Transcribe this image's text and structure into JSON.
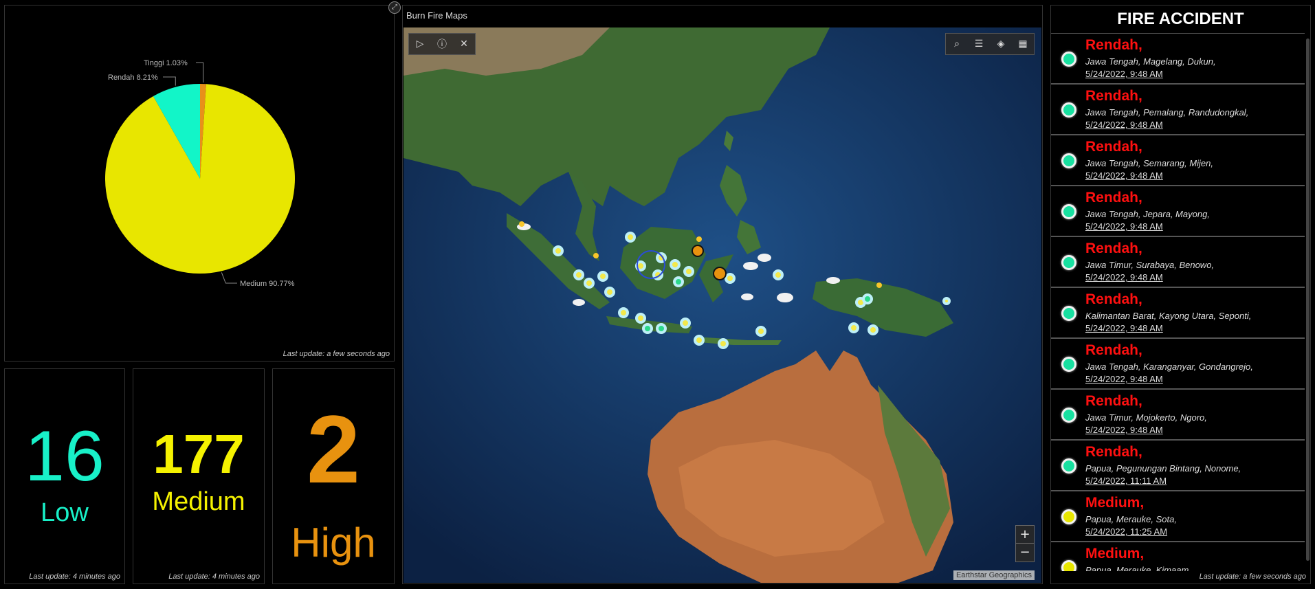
{
  "pie": {
    "footer": "Last update: a few seconds ago",
    "chart_data": {
      "type": "pie",
      "categories": [
        "Tinggi",
        "Rendah",
        "Medium"
      ],
      "values": [
        1.03,
        8.21,
        90.77
      ],
      "labels": [
        "Tinggi 1.03%",
        "Rendah 8.21%",
        "Medium 90.77%"
      ],
      "colors": [
        "#e8901a",
        "#12f5c8",
        "#e8e600"
      ]
    }
  },
  "indicators": [
    {
      "value": "16",
      "label": "Low",
      "color": "#18f0c8",
      "footer": "Last update: 4 minutes ago"
    },
    {
      "value": "177",
      "label": "Medium",
      "color": "#f5f200",
      "footer": "Last update: 4 minutes ago"
    },
    {
      "value": "2",
      "label": "High",
      "color": "#e8920f",
      "footer": ""
    }
  ],
  "map": {
    "title": "Burn Fire Maps",
    "attribution": "Earthstar Geographics",
    "zoom_in": "+",
    "zoom_out": "−"
  },
  "list": {
    "title": "FIRE ACCIDENT",
    "footer": "Last update: a few seconds ago",
    "items": [
      {
        "level": "Rendah,",
        "location": "Jawa Tengah, Magelang, Dukun,",
        "date": "5/24/2022, 9:48 AM",
        "dot": "#18e0a0"
      },
      {
        "level": "Rendah,",
        "location": "Jawa Tengah, Pemalang, Randudongkal,",
        "date": "5/24/2022, 9:48 AM",
        "dot": "#18e0a0"
      },
      {
        "level": "Rendah,",
        "location": "Jawa Tengah, Semarang, Mijen,",
        "date": "5/24/2022, 9:48 AM",
        "dot": "#18e0a0"
      },
      {
        "level": "Rendah,",
        "location": "Jawa Tengah, Jepara, Mayong,",
        "date": "5/24/2022, 9:48 AM",
        "dot": "#18e0a0"
      },
      {
        "level": "Rendah,",
        "location": "Jawa Timur, Surabaya, Benowo,",
        "date": "5/24/2022, 9:48 AM",
        "dot": "#18e0a0"
      },
      {
        "level": "Rendah,",
        "location": "Kalimantan Barat, Kayong Utara, Seponti,",
        "date": "5/24/2022, 9:48 AM",
        "dot": "#18e0a0"
      },
      {
        "level": "Rendah,",
        "location": "Jawa Tengah, Karanganyar, Gondangrejo,",
        "date": "5/24/2022, 9:48 AM",
        "dot": "#18e0a0"
      },
      {
        "level": "Rendah,",
        "location": "Jawa Timur, Mojokerto, Ngoro,",
        "date": "5/24/2022, 9:48 AM",
        "dot": "#18e0a0"
      },
      {
        "level": "Rendah,",
        "location": "Papua, Pegunungan Bintang, Nonome,",
        "date": "5/24/2022, 11:11 AM",
        "dot": "#18e0a0"
      },
      {
        "level": "Medium,",
        "location": "Papua, Merauke, Sota,",
        "date": "5/24/2022, 11:25 AM",
        "dot": "#e8e600"
      },
      {
        "level": "Medium,",
        "location": "Papua, Merauke, Kimaam,",
        "date": "",
        "dot": "#e8e600"
      }
    ]
  }
}
